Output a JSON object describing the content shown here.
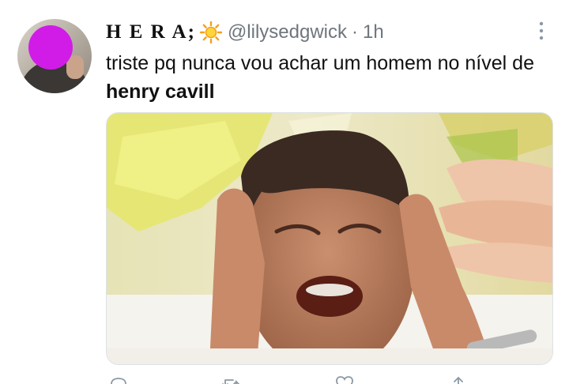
{
  "tweet": {
    "display_name": "H E R A;",
    "name_emoji": "sun-icon",
    "handle": "@lilysedgwick",
    "separator": "·",
    "time": "1h",
    "text_before": "triste pq nunca vou achar um homem no nível de ",
    "text_bold": "henry cavill"
  },
  "colors": {
    "name": "#111111",
    "secondary": "#6e767d",
    "avatar_mask": "#d11ce8",
    "sun": "#f4a11c"
  },
  "icons": [
    "sun-icon",
    "more-vertical-icon",
    "reply-icon",
    "retweet-icon",
    "like-icon",
    "share-icon"
  ]
}
